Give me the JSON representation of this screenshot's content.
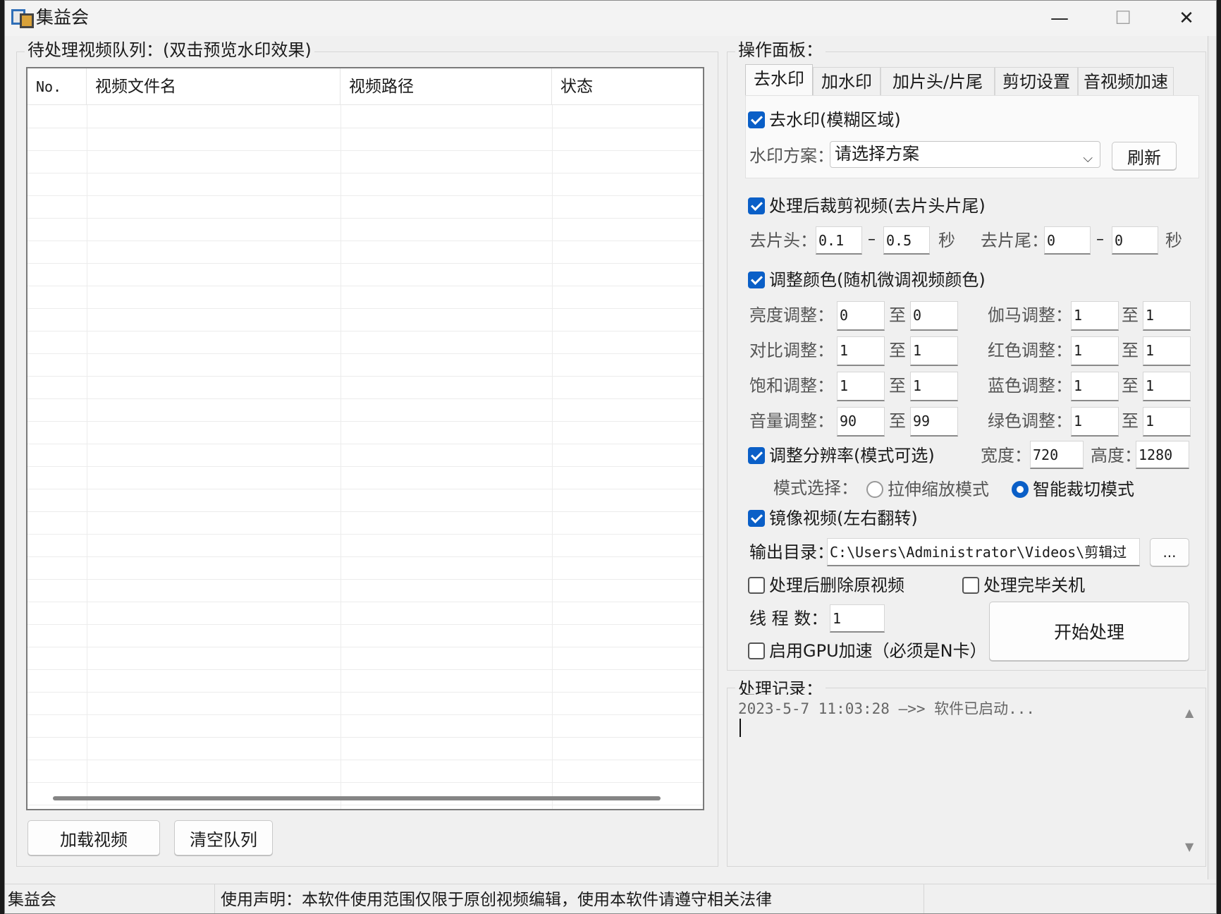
{
  "window": {
    "title": "集益会",
    "minimize": "—",
    "maximize": "☐",
    "close": "✕"
  },
  "queue": {
    "group_title": "待处理视频队列：(双击预览水印效果)",
    "columns": [
      "No.",
      "视频文件名",
      "视频路径",
      "状态"
    ],
    "rows": [],
    "load_button": "加载视频",
    "clear_button": "清空队列"
  },
  "panel": {
    "group_title": "操作面板：",
    "tabs": [
      "去水印",
      "加水印",
      "加片头/片尾",
      "剪切设置",
      "音视频加速"
    ],
    "active_tab": 0,
    "remove_watermark": {
      "label": "去水印(模糊区域)",
      "checked": true
    },
    "scheme": {
      "label": "水印方案：",
      "value": "请选择方案",
      "refresh": "刷新"
    },
    "trim": {
      "label": "处理后裁剪视频(去片头片尾)",
      "checked": true,
      "head_label": "去片头：",
      "head_from": "0.1",
      "head_to": "0.5",
      "tail_label": "去片尾：",
      "tail_from": "0",
      "tail_to": "0",
      "dash": "–",
      "unit": "秒"
    },
    "color": {
      "label": "调整颜色(随机微调视频颜色)",
      "checked": true,
      "to": "至",
      "items": [
        {
          "label": "亮度调整：",
          "from": "0",
          "to": "0"
        },
        {
          "label": "伽马调整：",
          "from": "1",
          "to": "1"
        },
        {
          "label": "对比调整：",
          "from": "1",
          "to": "1"
        },
        {
          "label": "红色调整：",
          "from": "1",
          "to": "1"
        },
        {
          "label": "饱和调整：",
          "from": "1",
          "to": "1"
        },
        {
          "label": "蓝色调整：",
          "from": "1",
          "to": "1"
        },
        {
          "label": "音量调整：",
          "from": "90",
          "to": "99"
        },
        {
          "label": "绿色调整：",
          "from": "1",
          "to": "1"
        }
      ]
    },
    "resolution": {
      "label": "调整分辨率(模式可选)",
      "checked": true,
      "width_label": "宽度：",
      "width": "720",
      "height_label": "高度：",
      "height": "1280",
      "mode_label": "模式选择：",
      "mode_stretch": "拉伸缩放模式",
      "mode_crop": "智能裁切模式",
      "selected_mode": "智能裁切模式"
    },
    "mirror": {
      "label": "镜像视频(左右翻转)",
      "checked": true
    },
    "output": {
      "label": "输出目录：",
      "path": "C:\\Users\\Administrator\\Videos\\剪辑过",
      "browse": "..."
    },
    "delete_original": {
      "label": "处理后删除原视频",
      "checked": false
    },
    "shutdown": {
      "label": "处理完毕关机",
      "checked": false
    },
    "threads": {
      "label": "线 程 数：",
      "value": "1"
    },
    "gpu": {
      "label": "启用GPU加速（必须是N卡）",
      "checked": false
    },
    "start_button": "开始处理"
  },
  "log": {
    "group_title": "处理记录：",
    "lines": [
      "2023-5-7 11:03:28 —>> 软件已启动..."
    ]
  },
  "statusbar": {
    "app": "集益会",
    "notice": "使用声明：本软件使用范围仅限于原创视频编辑，使用本软件请遵守相关法律"
  },
  "colors": {
    "accent": "#0a5fc7",
    "window_bg": "#f0f0f0",
    "titlebar_bg": "#f3f3f3"
  }
}
